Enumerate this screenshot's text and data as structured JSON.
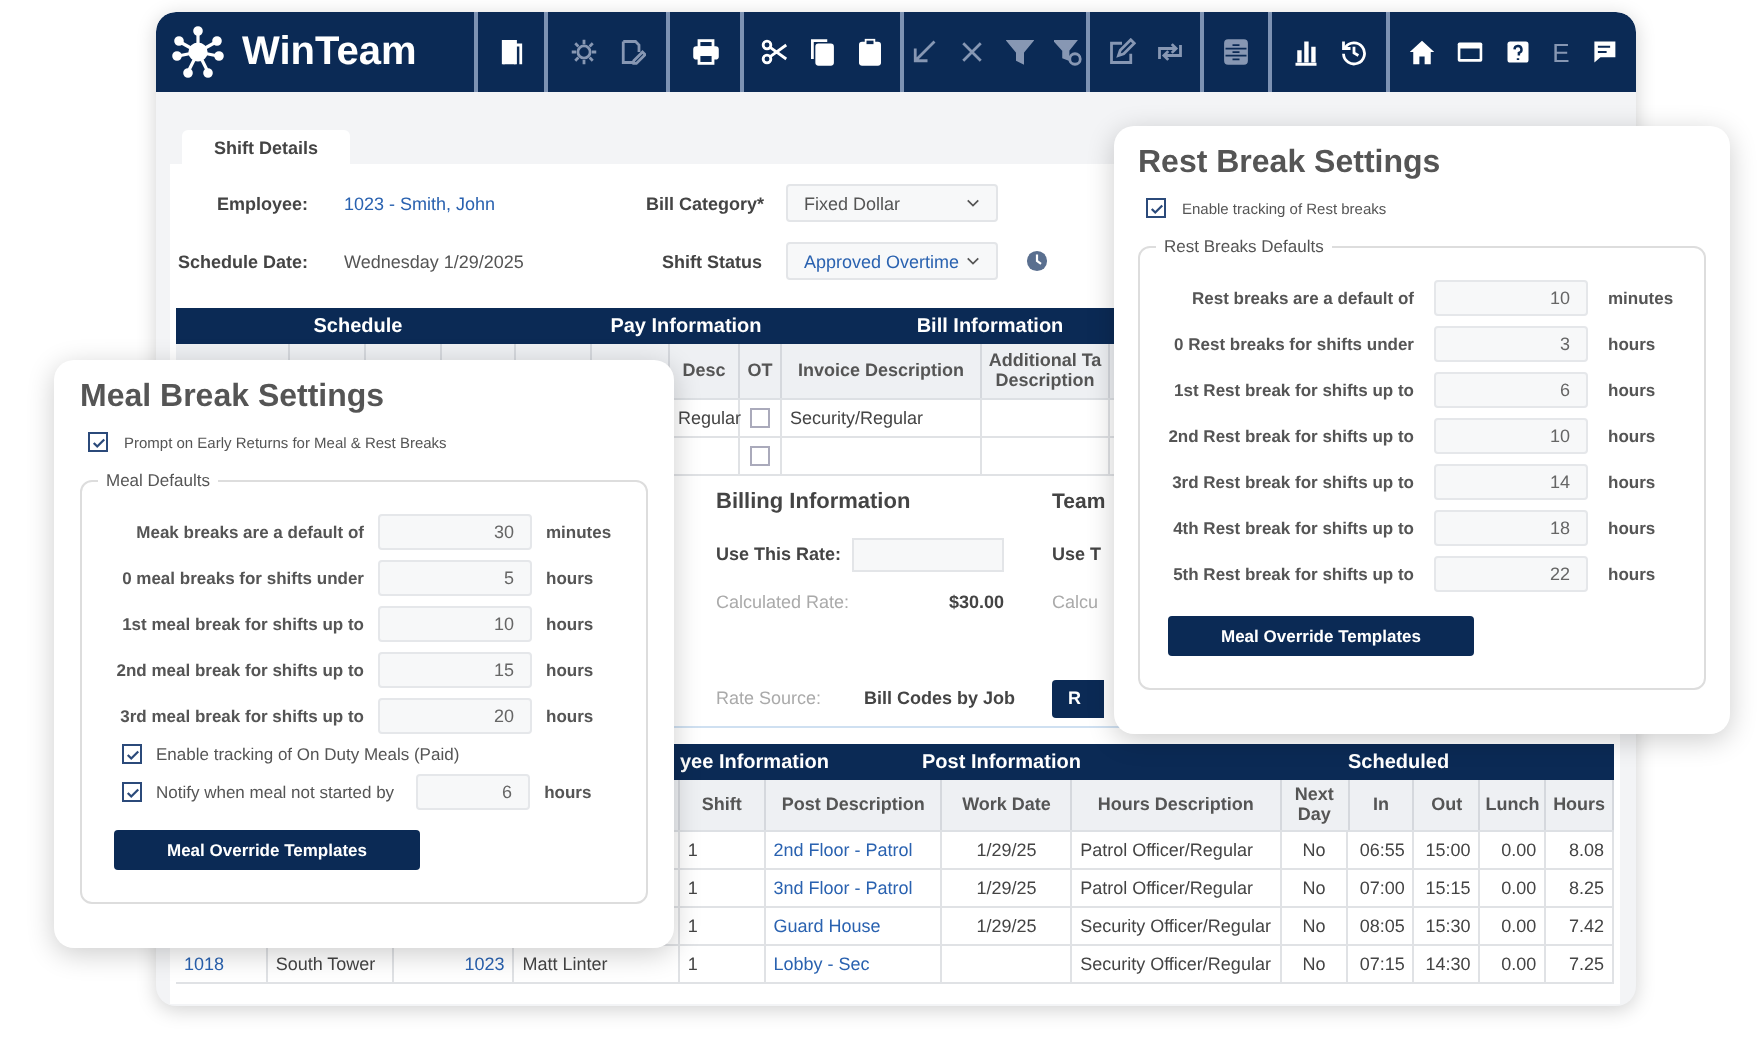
{
  "app": {
    "name": "WinTeam"
  },
  "toolbar": [
    [
      {
        "kind": "door",
        "disabled": false
      }
    ],
    [
      {
        "kind": "gear",
        "disabled": true
      },
      {
        "kind": "note",
        "disabled": true
      }
    ],
    [
      {
        "kind": "printer",
        "disabled": false
      }
    ],
    [
      {
        "kind": "scissors",
        "disabled": false
      },
      {
        "kind": "copy",
        "disabled": false
      },
      {
        "kind": "clipboard",
        "disabled": false
      }
    ],
    [
      {
        "kind": "arrow",
        "disabled": true
      },
      {
        "kind": "cross",
        "disabled": true
      },
      {
        "kind": "filter",
        "disabled": true
      },
      {
        "kind": "unfilter",
        "disabled": true
      }
    ],
    [
      {
        "kind": "pencil",
        "disabled": true
      },
      {
        "kind": "swap",
        "disabled": true
      }
    ],
    [
      {
        "kind": "storage",
        "disabled": true
      }
    ],
    [
      {
        "kind": "chart",
        "disabled": false
      },
      {
        "kind": "history",
        "disabled": false
      }
    ],
    [
      {
        "kind": "home",
        "disabled": false
      },
      {
        "kind": "window",
        "disabled": false
      },
      {
        "kind": "help",
        "disabled": false
      },
      {
        "kind": "letter",
        "label": "E",
        "disabled": true
      },
      {
        "kind": "chat",
        "disabled": false
      }
    ]
  ],
  "tab": {
    "label": "Shift Details",
    "selected": true
  },
  "form": {
    "employee": {
      "label": "Employee:",
      "value": "1023 - Smith, John"
    },
    "schedule_date": {
      "label": "Schedule Date:",
      "value": "Wednesday 1/29/2025"
    },
    "bill_category": {
      "label": "Bill Category*",
      "value": "Fixed Dollar"
    },
    "shift_status": {
      "label": "Shift Status",
      "value": "Approved Overtime"
    }
  },
  "pay_table": {
    "groups": [
      "Schedule",
      "Pay Information",
      "Bill Information"
    ],
    "columns": [
      "Desc",
      "OT",
      "Invoice Description",
      "Additional Ta\nDescription"
    ],
    "rows": [
      {
        "desc": "Regular",
        "ot": false,
        "invoice": "Security/Regular"
      },
      {
        "ot": false
      }
    ]
  },
  "billing": {
    "title": "Billing Information",
    "use_rate_label": "Use This Rate:",
    "calc_label": "Calculated Rate:",
    "calc_value": "$30.00",
    "source_label": "Rate Source:",
    "source_value": "Bill Codes by Job"
  },
  "team": {
    "title": "Team",
    "use_rate_label": "Use T",
    "calc_label": "Calcu",
    "button": "R"
  },
  "post_table": {
    "groups": [
      "yee Information",
      "Post Information",
      "Scheduled"
    ],
    "columns": [
      "Shift",
      "Post Description",
      "Work Date",
      "Hours Description",
      "Next\nDay",
      "In",
      "Out",
      "Lunch",
      "Hours"
    ],
    "rows": [
      {
        "shift": "1",
        "post": "2nd Floor - Patrol",
        "date": "1/29/25",
        "hdesc": "Patrol Officer/Regular",
        "next": "No",
        "in": "06:55",
        "out": "15:00",
        "lunch": "0.00",
        "hours": "8.08"
      },
      {
        "shift": "1",
        "post": "3nd Floor - Patrol",
        "date": "1/29/25",
        "hdesc": "Patrol Officer/Regular",
        "next": "No",
        "in": "07:00",
        "out": "15:15",
        "lunch": "0.00",
        "hours": "8.25"
      },
      {
        "shift": "1",
        "post": "Guard House",
        "date": "1/29/25",
        "hdesc": "Security Officer/Regular",
        "next": "No",
        "in": "08:05",
        "out": "15:30",
        "lunch": "0.00",
        "hours": "7.42"
      },
      {
        "job": "1018",
        "site": "South Tower",
        "emp": "1023",
        "name": "Matt Linter",
        "shift": "1",
        "post": "Lobby - Sec",
        "hdesc": "Security Officer/Regular",
        "next": "No",
        "in": "07:15",
        "out": "14:30",
        "lunch": "0.00",
        "hours": "7.25"
      }
    ]
  },
  "meal": {
    "title": "Meal Break Settings",
    "prompt": {
      "label": "Prompt on Early Returns for Meal & Rest Breaks",
      "checked": true
    },
    "group_title": "Meal Defaults",
    "rows": [
      {
        "label": "Meak breaks are a default of",
        "value": "30",
        "unit": "minutes"
      },
      {
        "label": "0 meal breaks for shifts under",
        "value": "5",
        "unit": "hours"
      },
      {
        "label": "1st meal break for shifts up to",
        "value": "10",
        "unit": "hours"
      },
      {
        "label": "2nd meal break for shifts up to",
        "value": "15",
        "unit": "hours"
      },
      {
        "label": "3rd meal break for shifts up to",
        "value": "20",
        "unit": "hours"
      }
    ],
    "options": [
      {
        "label": "Enable tracking of On Duty Meals (Paid)",
        "checked": true
      },
      {
        "label": "Notify when meal not started by",
        "checked": true,
        "value": "6",
        "unit": "hours"
      }
    ],
    "button": "Meal Override Templates"
  },
  "rest": {
    "title": "Rest Break Settings",
    "enable": {
      "label": "Enable tracking of Rest breaks",
      "checked": true
    },
    "group_title": "Rest Breaks Defaults",
    "rows": [
      {
        "label": "Rest breaks are a default of",
        "value": "10",
        "unit": "minutes"
      },
      {
        "label": "0 Rest breaks for shifts under",
        "value": "3",
        "unit": "hours"
      },
      {
        "label": "1st Rest break for shifts up to",
        "value": "6",
        "unit": "hours"
      },
      {
        "label": "2nd Rest break for shifts up to",
        "value": "10",
        "unit": "hours"
      },
      {
        "label": "3rd Rest break for shifts up to",
        "value": "14",
        "unit": "hours"
      },
      {
        "label": "4th Rest break for shifts up to",
        "value": "18",
        "unit": "hours"
      },
      {
        "label": "5th Rest break for shifts up to",
        "value": "22",
        "unit": "hours"
      }
    ],
    "button": "Meal Override Templates"
  }
}
